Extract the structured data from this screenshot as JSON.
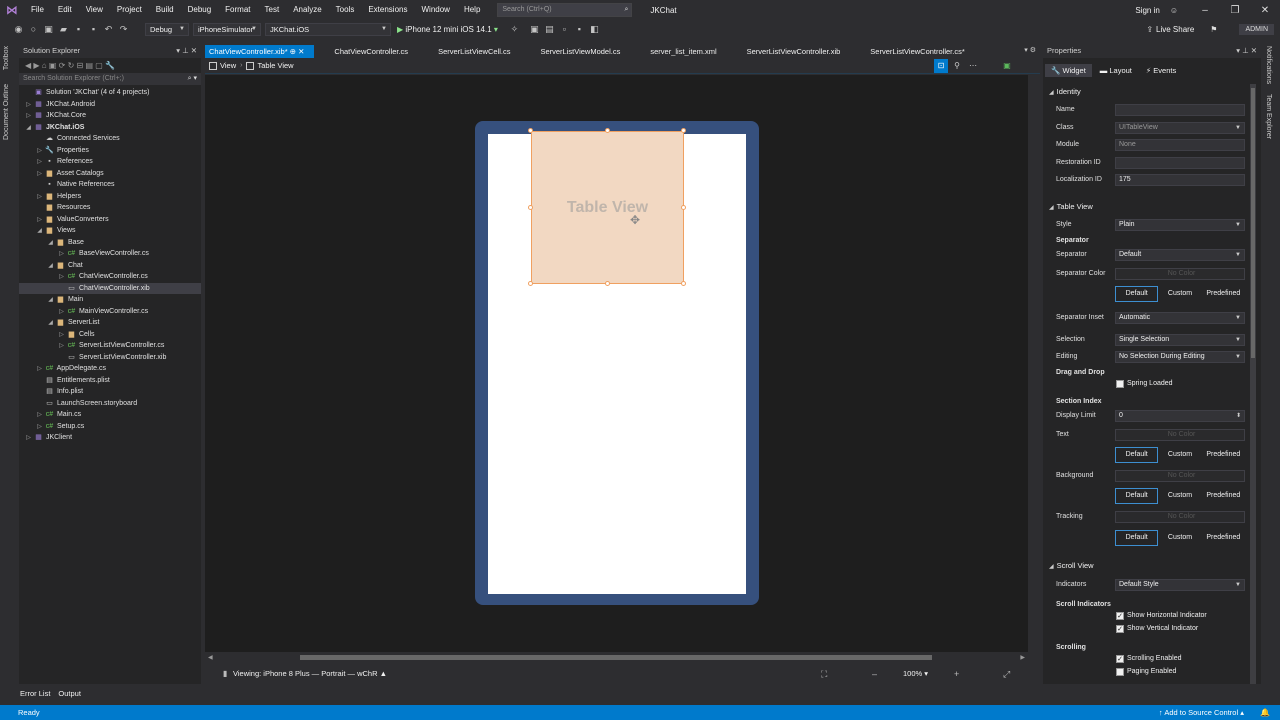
{
  "menu": [
    "File",
    "Edit",
    "View",
    "Project",
    "Build",
    "Debug",
    "Format",
    "Test",
    "Analyze",
    "Tools",
    "Extensions",
    "Window",
    "Help"
  ],
  "search": {
    "placeholder": "Search (Ctrl+Q)"
  },
  "solution_name": "JKChat",
  "sign_in": "Sign in",
  "live_share": "Live Share",
  "admin": "ADMIN",
  "toolbar": {
    "config": "Debug",
    "platform": "iPhoneSimulator",
    "project": "JKChat.iOS",
    "run_target": "iPhone 12 mini iOS 14.1"
  },
  "left_strip": [
    "Toolbox",
    "Document Outline"
  ],
  "right_strip": [
    "Notifications",
    "Team Explorer"
  ],
  "solution_explorer": {
    "title": "Solution Explorer",
    "search_placeholder": "Search Solution Explorer (Ctrl+;)",
    "tree": [
      {
        "indent": 0,
        "exp": "",
        "icon": "solution-icon",
        "glyph": "▣",
        "cls": "ic-proj",
        "label": "Solution 'JKChat' (4 of 4 projects)"
      },
      {
        "indent": 0,
        "exp": "▷",
        "icon": "csproject-icon",
        "glyph": "▦",
        "cls": "ic-proj",
        "label": "JKChat.Android"
      },
      {
        "indent": 0,
        "exp": "▷",
        "icon": "csproject-icon",
        "glyph": "▦",
        "cls": "ic-proj",
        "label": "JKChat.Core"
      },
      {
        "indent": 0,
        "exp": "◢",
        "icon": "csproject-icon",
        "glyph": "▦",
        "cls": "ic-proj",
        "label": "JKChat.iOS",
        "bold": true
      },
      {
        "indent": 1,
        "exp": "",
        "icon": "connected-services-icon",
        "glyph": "☁",
        "cls": "ic-file",
        "label": "Connected Services"
      },
      {
        "indent": 1,
        "exp": "▷",
        "icon": "wrench-icon",
        "glyph": "🔧",
        "cls": "ic-file",
        "label": "Properties"
      },
      {
        "indent": 1,
        "exp": "▷",
        "icon": "references-icon",
        "glyph": "▪",
        "cls": "ic-file",
        "label": "References"
      },
      {
        "indent": 1,
        "exp": "▷",
        "icon": "folder-icon",
        "glyph": "▆",
        "cls": "ic-folder",
        "label": "Asset Catalogs"
      },
      {
        "indent": 1,
        "exp": "",
        "icon": "references-icon",
        "glyph": "▪",
        "cls": "ic-file",
        "label": "Native References"
      },
      {
        "indent": 1,
        "exp": "▷",
        "icon": "folder-icon",
        "glyph": "▆",
        "cls": "ic-folder",
        "label": "Helpers"
      },
      {
        "indent": 1,
        "exp": "",
        "icon": "folder-icon",
        "glyph": "▆",
        "cls": "ic-folder",
        "label": "Resources"
      },
      {
        "indent": 1,
        "exp": "▷",
        "icon": "folder-icon",
        "glyph": "▆",
        "cls": "ic-folder",
        "label": "ValueConverters"
      },
      {
        "indent": 1,
        "exp": "◢",
        "icon": "folder-icon",
        "glyph": "▆",
        "cls": "ic-folder",
        "label": "Views"
      },
      {
        "indent": 2,
        "exp": "◢",
        "icon": "folder-icon",
        "glyph": "▆",
        "cls": "ic-folder",
        "label": "Base"
      },
      {
        "indent": 3,
        "exp": "▷",
        "icon": "csharp-file-icon",
        "glyph": "c#",
        "cls": "ic-cs",
        "label": "BaseViewController.cs"
      },
      {
        "indent": 2,
        "exp": "◢",
        "icon": "folder-icon",
        "glyph": "▆",
        "cls": "ic-folder",
        "label": "Chat"
      },
      {
        "indent": 3,
        "exp": "▷",
        "icon": "csharp-file-icon",
        "glyph": "c#",
        "cls": "ic-cs",
        "label": "ChatViewController.cs"
      },
      {
        "indent": 3,
        "exp": "",
        "icon": "xib-file-icon",
        "glyph": "▭",
        "cls": "ic-file",
        "label": "ChatViewController.xib",
        "selected": true
      },
      {
        "indent": 2,
        "exp": "◢",
        "icon": "folder-icon",
        "glyph": "▆",
        "cls": "ic-folder",
        "label": "Main"
      },
      {
        "indent": 3,
        "exp": "▷",
        "icon": "csharp-file-icon",
        "glyph": "c#",
        "cls": "ic-cs",
        "label": "MainViewController.cs"
      },
      {
        "indent": 2,
        "exp": "◢",
        "icon": "folder-icon",
        "glyph": "▆",
        "cls": "ic-folder",
        "label": "ServerList"
      },
      {
        "indent": 3,
        "exp": "▷",
        "icon": "folder-icon",
        "glyph": "▆",
        "cls": "ic-folder",
        "label": "Cells"
      },
      {
        "indent": 3,
        "exp": "▷",
        "icon": "csharp-file-icon",
        "glyph": "c#",
        "cls": "ic-cs",
        "label": "ServerListViewController.cs"
      },
      {
        "indent": 3,
        "exp": "",
        "icon": "xib-file-icon",
        "glyph": "▭",
        "cls": "ic-file",
        "label": "ServerListViewController.xib"
      },
      {
        "indent": 1,
        "exp": "▷",
        "icon": "csharp-file-icon",
        "glyph": "c#",
        "cls": "ic-cs",
        "label": "AppDelegate.cs"
      },
      {
        "indent": 1,
        "exp": "",
        "icon": "plist-file-icon",
        "glyph": "▤",
        "cls": "ic-file",
        "label": "Entitlements.plist"
      },
      {
        "indent": 1,
        "exp": "",
        "icon": "plist-file-icon",
        "glyph": "▤",
        "cls": "ic-file",
        "label": "Info.plist"
      },
      {
        "indent": 1,
        "exp": "",
        "icon": "storyboard-file-icon",
        "glyph": "▭",
        "cls": "ic-file",
        "label": "LaunchScreen.storyboard"
      },
      {
        "indent": 1,
        "exp": "▷",
        "icon": "csharp-file-icon",
        "glyph": "c#",
        "cls": "ic-cs",
        "label": "Main.cs"
      },
      {
        "indent": 1,
        "exp": "▷",
        "icon": "csharp-file-icon",
        "glyph": "c#",
        "cls": "ic-cs",
        "label": "Setup.cs"
      },
      {
        "indent": 0,
        "exp": "▷",
        "icon": "csproject-icon",
        "glyph": "▦",
        "cls": "ic-proj",
        "label": "JKClient"
      }
    ]
  },
  "tabs": [
    {
      "label": "ChatViewController.xib*",
      "active": true
    },
    {
      "label": "ChatViewController.cs"
    },
    {
      "label": "ServerListViewCell.cs"
    },
    {
      "label": "ServerListViewModel.cs"
    },
    {
      "label": "server_list_item.xml"
    },
    {
      "label": "ServerListViewController.xib"
    },
    {
      "label": "ServerListViewController.cs*"
    }
  ],
  "breadcrumb": {
    "root": "View",
    "child": "Table View"
  },
  "designer": {
    "table_view_label": "Table View",
    "viewing": "Viewing: iPhone 8 Plus — Portrait — wChR",
    "zoom": "100%"
  },
  "properties": {
    "title": "Properties",
    "tabs": [
      "Widget",
      "Layout",
      "Events"
    ],
    "identity": {
      "header": "Identity",
      "name_label": "Name",
      "name_value": "",
      "class_label": "Class",
      "class_value": "UITableView",
      "module_label": "Module",
      "module_value": "None",
      "restoration_label": "Restoration ID",
      "restoration_value": "",
      "localization_label": "Localization ID",
      "localization_value": "175"
    },
    "table_view": {
      "header": "Table View",
      "style_label": "Style",
      "style_value": "Plain",
      "separator_header": "Separator",
      "separator_label": "Separator",
      "separator_value": "Default",
      "separator_color_label": "Separator Color",
      "separator_color_value": "No Color",
      "seg": [
        "Default",
        "Custom",
        "Predefined"
      ],
      "separator_inset_label": "Separator Inset",
      "separator_inset_value": "Automatic",
      "selection_label": "Selection",
      "selection_value": "Single Selection",
      "editing_label": "Editing",
      "editing_value": "No Selection During Editing",
      "drag_drop_header": "Drag and Drop",
      "spring_loaded": "Spring Loaded",
      "section_index_header": "Section Index",
      "display_limit_label": "Display Limit",
      "display_limit_value": "0",
      "text_label": "Text",
      "text_value": "No Color",
      "background_label": "Background",
      "background_value": "No Color",
      "tracking_label": "Tracking",
      "tracking_value": "No Color"
    },
    "scroll_view": {
      "header": "Scroll View",
      "indicators_label": "Indicators",
      "indicators_value": "Default Style",
      "scroll_indicators_header": "Scroll Indicators",
      "show_horizontal": "Show Horizontal Indicator",
      "show_vertical": "Show Vertical Indicator",
      "scrolling_header": "Scrolling",
      "scrolling_enabled": "Scrolling Enabled",
      "paging_enabled": "Paging Enabled"
    }
  },
  "bottom_tabs": [
    "Error List",
    "Output"
  ],
  "status": {
    "ready": "Ready",
    "source_control": "Add to Source Control"
  },
  "colors": {
    "accent": "#007acc",
    "device_frame": "#36507d",
    "table_view_fill": "#f2d8c2",
    "selection_border": "#f0a060"
  }
}
